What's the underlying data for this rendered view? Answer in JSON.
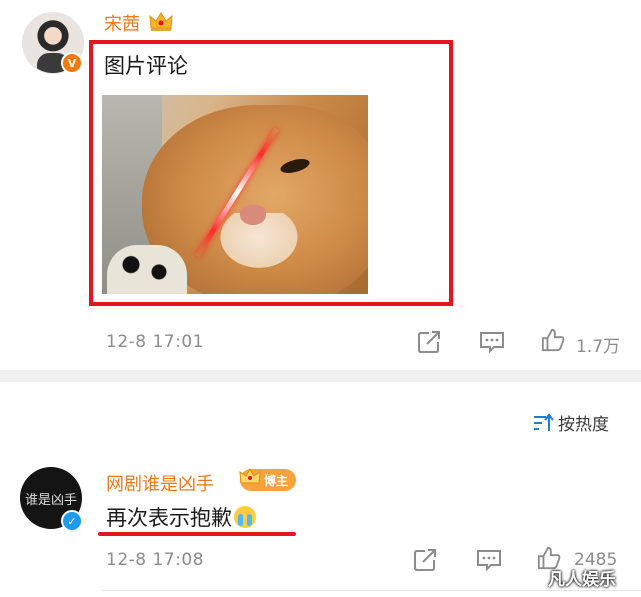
{
  "comment1": {
    "username": "宋茜",
    "text": "图片评论",
    "time": "12-8 17:01",
    "like_count": "1.7万"
  },
  "sort": {
    "label": "按热度"
  },
  "comment2": {
    "username": "网剧谁是凶手",
    "badge": "博主",
    "avatar_text": "谁是凶手",
    "text": "再次表示抱歉",
    "time": "12-8 17:08",
    "like_count": "2485"
  },
  "watermark": "凡人娱乐",
  "colors": {
    "username": "#ef7a1a",
    "highlight_red": "#e6141e",
    "verified_orange": "#f5780a",
    "verified_blue": "#1e9bf0",
    "meta_gray": "#8c8c8c"
  },
  "icons": {
    "share": "share-icon",
    "comment": "comment-icon",
    "like": "thumbs-up-icon",
    "sort": "sort-icon",
    "crown": "crown-icon"
  }
}
